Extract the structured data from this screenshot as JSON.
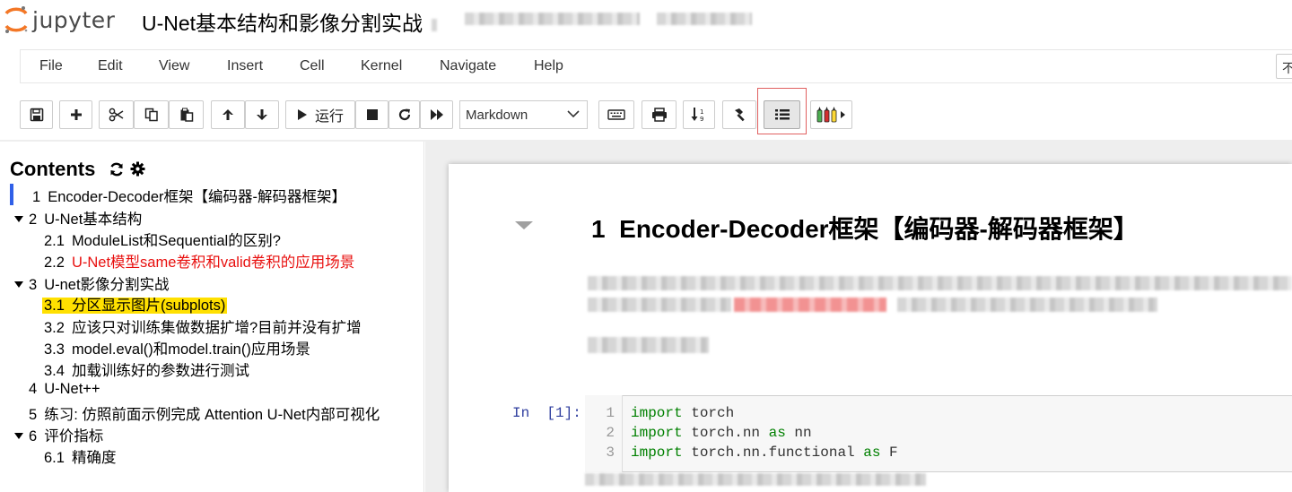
{
  "header": {
    "logo_text": "jupyter",
    "notebook_title": "U-Net基本结构和影像分割实战"
  },
  "menubar": {
    "items": [
      "File",
      "Edit",
      "View",
      "Insert",
      "Cell",
      "Kernel",
      "Navigate",
      "Help"
    ],
    "kernel_indicator": "不"
  },
  "toolbar": {
    "run_label": "运行",
    "cell_type": "Markdown",
    "icons": [
      "save-icon",
      "plus-icon",
      "scissors-icon",
      "copy-icon",
      "paste-icon",
      "arrow-up-icon",
      "arrow-down-icon",
      "play-icon",
      "stop-icon",
      "restart-icon",
      "fast-forward-icon",
      "keyboard-icon",
      "printer-icon",
      "sort-icon",
      "hammer-icon",
      "list-icon",
      "markers-icon"
    ]
  },
  "toc": {
    "title": "Contents",
    "items": [
      {
        "num": "1",
        "label": "Encoder-Decoder框架【编码器-解码器框架】"
      },
      {
        "num": "2",
        "label": "U-Net基本结构"
      },
      {
        "num": "2.1",
        "label": "ModuleList和Sequential的区别?"
      },
      {
        "num": "2.2",
        "label": "U-Net模型same卷积和valid卷积的应用场景"
      },
      {
        "num": "3",
        "label": "U-net影像分割实战"
      },
      {
        "num": "3.1",
        "label": "分区显示图片(subplots)"
      },
      {
        "num": "3.2",
        "label": "应该只对训练集做数据扩增?目前并没有扩增"
      },
      {
        "num": "3.3",
        "label": "model.eval()和model.train()应用场景"
      },
      {
        "num": "3.4",
        "label": "加载训练好的参数进行测试"
      },
      {
        "num": "4",
        "label": "U-Net++"
      },
      {
        "num": "5",
        "label": "练习: 仿照前面示例完成 Attention U-Net内部可视化"
      },
      {
        "num": "6",
        "label": "评价指标"
      },
      {
        "num": "6.1",
        "label": "精确度"
      }
    ]
  },
  "notebook": {
    "heading_num": "1",
    "heading_text": "Encoder-Decoder框架【编码器-解码器框架】",
    "prompt": "In  [1]:",
    "code": {
      "line_numbers": [
        "1",
        "2",
        "3"
      ],
      "lines": [
        {
          "kw1": "import",
          "mid": " torch",
          "kw2": "",
          "tail": ""
        },
        {
          "kw1": "import",
          "mid": " torch.nn ",
          "kw2": "as",
          "tail": " nn"
        },
        {
          "kw1": "import",
          "mid": " torch.nn.functional ",
          "kw2": "as",
          "tail": " F"
        }
      ]
    }
  },
  "colors": {
    "toc_marker": "#3060e8",
    "toc_red": "#e8100f",
    "toc_highlight": "#ffe000",
    "keyword": "#008000",
    "prompt": "#303f9f"
  }
}
